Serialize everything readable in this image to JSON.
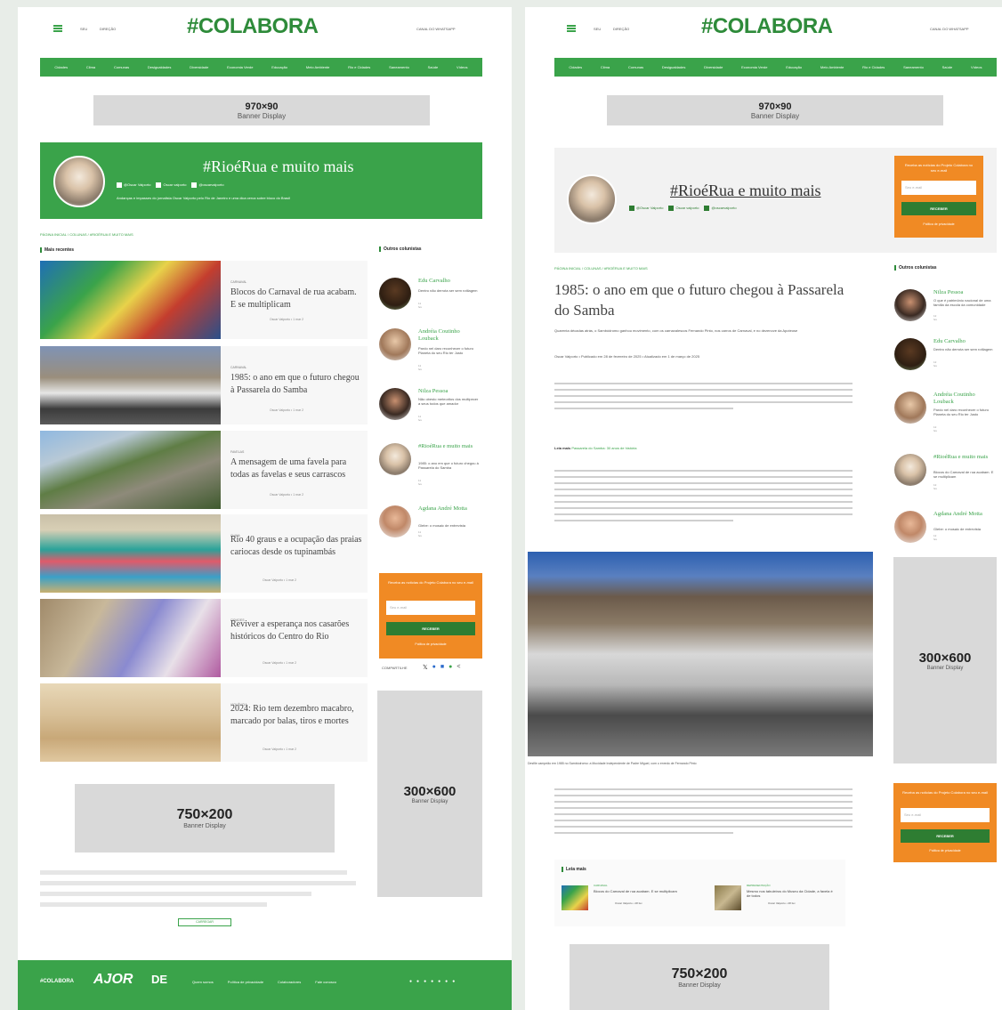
{
  "header": {
    "logo": "#COLABORA",
    "menu_links": [
      "SEU",
      "DIREÇÃO"
    ],
    "right_link": "CANAL DO WHATSAPP"
  },
  "nav_items": [
    "Cidades",
    "Clima",
    "Comunas",
    "Desigualdades",
    "Diversidade",
    "Economia Verde",
    "Educação",
    "Meio Ambiente",
    "Rio e Cidades",
    "Saneamento",
    "Saúde",
    "Vídeos"
  ],
  "banners": {
    "top": {
      "size": "970×90",
      "label": "Banner Display"
    },
    "bottom": {
      "size": "750×200",
      "label": "Banner Display"
    },
    "side": {
      "size": "300×600",
      "label": "Banner Display"
    }
  },
  "column": {
    "title": "#RioéRua e muito mais",
    "social": [
      "@Oscar Valporto",
      "Oscar valporto",
      "@oscarvalporto"
    ],
    "description": "Andanças e impasses do jornalista Oscar Valporto pelo Rio de Janeiro e uma dica cerca sobre bloco do Brasil"
  },
  "left_page": {
    "breadcrumb": "PÁGINA INICIAL  /  COLUNAS  /  #RIOÉRUA E MUITO MAIS",
    "recent_title": "Mais recentes",
    "other_title": "Outros colunistas",
    "articles": [
      {
        "category": "CARNAVAL",
        "title": "Blocos do Carnaval de rua acabam. E se multiplicam",
        "meta": "Oscar Valporto  •  1 mar 2"
      },
      {
        "category": "CARNAVAL",
        "title": "1985: o ano em que o futuro chegou à Passarela do Samba",
        "meta": "Oscar Valporto  •  1 mar 2"
      },
      {
        "category": "FAVELAS",
        "title": "A mensagem de uma favela para todas as favelas e seus carrascos",
        "meta": "Oscar Valporto  •  1 mar 2"
      },
      {
        "category": "CLIMA",
        "title": "Rio 40 graus e a ocupação das praias cariocas desde os tupinambás",
        "meta": "Oscar Valporto  •  1 mar 2"
      },
      {
        "category": "CIDADES",
        "title": "Reviver a esperança nos casarões históricos do Centro do Rio",
        "meta": "Oscar Valporto  •  1 mar 2"
      },
      {
        "category": "VIOLÊNCIA",
        "title": "2024: Rio tem dezembro macabro, marcado por balas, tiros e mortes",
        "meta": "Oscar Valporto  •  1 mar 2"
      }
    ],
    "columnists": [
      {
        "name": "Edu Carvalho",
        "desc": "Dentro não derrota ser sem rotilagem",
        "meta": "11 fev"
      },
      {
        "name": "Andréia Coutinho Louback",
        "desc": "Pardo nel daro reconhecer o futuro Planeta do seu Rio ter Justo",
        "meta": "11 fev"
      },
      {
        "name": "Nilza Pessoa",
        "desc": "Não obesto meteoritos dos multipecer a seus todos que amador",
        "meta": "11 fev"
      },
      {
        "name": "#RioéRua e muito mais",
        "desc": "1985: o ano em que o futuro chegou à Passarela do Samba",
        "meta": "11 fev"
      },
      {
        "name": "Agdana André Motta",
        "desc": "Glebe: o mosaic de entrevista",
        "meta": "11 fev"
      }
    ],
    "newsletter": {
      "text": "Receba as notícias do Projeto Colabora no seu e-mail",
      "placeholder": "Seu e-mail",
      "button": "RECEBER",
      "footer": "Política de privacidade"
    },
    "share_label": "COMPARTILHE",
    "load_more": "CARREGAR",
    "footer_links": [
      "Quem somos",
      "Política de privacidade",
      "Colaboradores",
      "Fale conosco"
    ],
    "footer_logo": "#COLABORA",
    "footer_partner1": "AJOR",
    "footer_partner2": "DE"
  },
  "right_page": {
    "breadcrumb": "PÁGINA INICIAL  /  COLUNAS  /  #RIOÉRUA E MUITO MAIS",
    "title": "1985: o ano em que o futuro chegou à Passarela do Samba",
    "subtitle": "Quarenta décadas atrás, o Sambódromo ganhou movimento, com os carnavalescos Fernando Pinto, nos carros de Carnaval, e no dezenove da Apoteose",
    "date": "Oscar Valporto  •  Publicado em 28 de fevereiro de 2025  •  Atualizado em 1 de março de 2025",
    "related_label": "Leia mais",
    "related_link": "Passarela do Samba: 30 anos de história",
    "caption": "Desfile campeão em 1985 no Sambódromo: a Mocidade Independente de Padre Miguel, com o enredo de Fernando Pinto",
    "leia_mais_title": "Leia mais",
    "leia_mais": [
      {
        "category": "CARNAVAL",
        "title": "Blocos do Carnaval de rua acabam. E se multiplicam",
        "meta": "Oscar Valporto  •  28 fev"
      },
      {
        "category": "REPRESENTAÇÃO",
        "title": "Mesmo nos tabuleiros do Museu da Cidade, a favela é de todos",
        "meta": "Oscar Valporto  •  28 fev"
      }
    ],
    "columnists": [
      {
        "name": "Nilza Pessoa",
        "desc": "O que é patrimônio nacional de uma família da escola da comunidade",
        "meta": "12 fev"
      },
      {
        "name": "Edu Carvalho",
        "desc": "Dentro não derrota ser sem rotilagem",
        "meta": "12 fev"
      },
      {
        "name": "Andréia Coutinho Louback",
        "desc": "Pardo nel daro reconhecer o futuro Planeta do seu Rio ter Justo",
        "meta": "12 fev"
      },
      {
        "name": "#RioéRua e muito mais",
        "desc": "Blocos do Carnaval de rua acabam. E se multiplicam",
        "meta": "12 fev"
      },
      {
        "name": "Agdana André Motta",
        "desc": "Glebe: o mosaic de entrevista",
        "meta": "12 fev"
      }
    ],
    "newsletter": {
      "text": "Receba as notícias do Projeto Colabora no seu e-mail",
      "placeholder": "Seu e-mail",
      "button": "RECEBER",
      "footer": "Política de privacidade"
    }
  },
  "colors": {
    "green": "#3aa34a",
    "dark_green": "#2e7d32",
    "orange": "#f08a24",
    "gray": "#d9d9d9"
  }
}
